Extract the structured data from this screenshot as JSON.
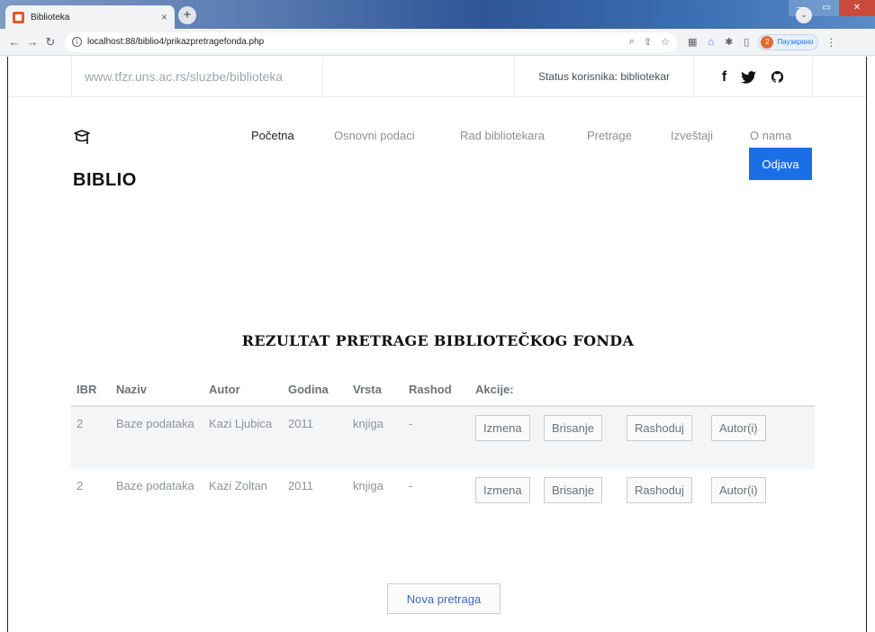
{
  "browser": {
    "tab_title": "Biblioteka",
    "tab_close": "×",
    "new_tab": "+",
    "url": "localhost:88/biblio4/prikazpretragefonda.php",
    "profile_initial": "2",
    "profile_label": "Паузирано"
  },
  "topbar": {
    "site_url": "www.tfzr.uns.ac.rs/sluzbe/biblioteka",
    "status": "Status korisnika: bibliotekar",
    "social": [
      "f",
      "twitter-icon",
      "github-icon"
    ]
  },
  "brand": "BIBLIO",
  "nav": {
    "items": [
      "Početna",
      "Osnovni podaci",
      "Rad bibliotekara",
      "Pretrage",
      "Izveštaji",
      "O nama"
    ],
    "active": "Početna",
    "logout": "Odjava"
  },
  "heading": "REZULTAT PRETRAGE BIBLIOTEČKOG FONDA",
  "table": {
    "headers": [
      "IBR",
      "Naziv",
      "Autor",
      "Godina",
      "Vrsta",
      "Rashod",
      "Akcije:"
    ],
    "rows": [
      {
        "ibr": "2",
        "naziv": "Baze podataka",
        "autor": "Kazi Ljubica",
        "godina": "2011",
        "vrsta": "knjiga",
        "rashod": "-"
      },
      {
        "ibr": "2",
        "naziv": "Baze podataka",
        "autor": "Kazi Zoltan",
        "godina": "2011",
        "vrsta": "knjiga",
        "rashod": "-"
      }
    ],
    "actions": [
      "Izmena",
      "Brisanje",
      "Rashoduj",
      "Autor(i)"
    ]
  },
  "new_search": "Nova pretraga",
  "colors": {
    "accent": "#1b6fe6",
    "link": "#3f6ab8",
    "muted_text": "#8c949b"
  }
}
